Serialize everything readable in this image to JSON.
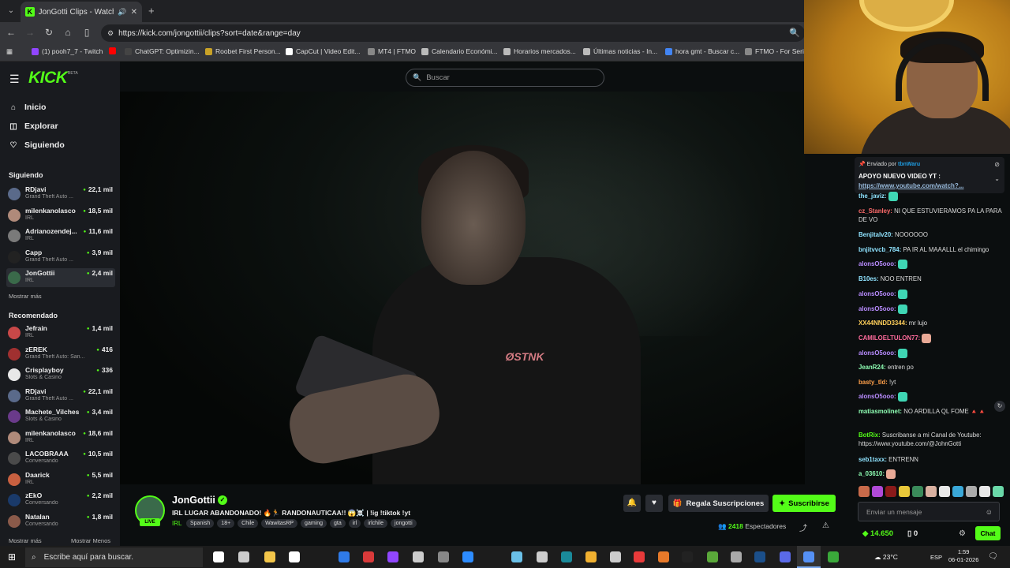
{
  "browser": {
    "tab_title": "JonGotti Clips - Watch Live",
    "url": "https://kick.com/jongottii/clips?sort=date&range=day",
    "bookmarks": [
      {
        "label": "(1) pooh7_7 - Twitch",
        "color": "#9146ff"
      },
      {
        "label": "",
        "color": "#ff0000"
      },
      {
        "label": "ChatGPT: Optimizin...",
        "color": "#444"
      },
      {
        "label": "Roobet First Person...",
        "color": "#c9a227"
      },
      {
        "label": "CapCut | Video Edit...",
        "color": "#ffffff"
      },
      {
        "label": "MT4 | FTMO",
        "color": "#888888"
      },
      {
        "label": "Calendario Económi...",
        "color": "#bbbbbb"
      },
      {
        "label": "Horarios mercados...",
        "color": "#bbbbbb"
      },
      {
        "label": "Últimas noticias - In...",
        "color": "#bbbbbb"
      },
      {
        "label": "hora gmt - Buscar c...",
        "color": "#4285f4"
      },
      {
        "label": "FTMO - For Serio",
        "color": "#888888"
      }
    ]
  },
  "kick": {
    "logo": "KICK",
    "logo_beta": "BETA",
    "search_placeholder": "Buscar",
    "nav": [
      {
        "label": "Inicio",
        "icon": "home-icon"
      },
      {
        "label": "Explorar",
        "icon": "compass-icon"
      },
      {
        "label": "Siguiendo",
        "icon": "heart-icon"
      }
    ],
    "following_title": "Siguiendo",
    "following": [
      {
        "name": "RDjavi",
        "category": "Grand Theft Auto ...",
        "viewers": "22,1 mil",
        "color": "#5a6a8a"
      },
      {
        "name": "milenkanolasco",
        "category": "IRL",
        "viewers": "18,5 mil",
        "color": "#b08a7a"
      },
      {
        "name": "Adrianozendej...",
        "category": "IRL",
        "viewers": "11,6 mil",
        "color": "#7a7a7a"
      },
      {
        "name": "Capp",
        "category": "Grand Theft Auto ...",
        "viewers": "3,9 mil",
        "color": "#222"
      },
      {
        "name": "JonGottii",
        "category": "IRL",
        "viewers": "2,4 mil",
        "color": "#3a6a4a"
      }
    ],
    "show_more_1": "Mostrar más",
    "recommended_title": "Recomendado",
    "recommended": [
      {
        "name": "Jefrain",
        "category": "IRL",
        "viewers": "1,4 mil",
        "color": "#c84848"
      },
      {
        "name": "zEREK",
        "category": "Grand Theft Auto: San...",
        "viewers": "416",
        "color": "#a03030"
      },
      {
        "name": "Crisplayboy",
        "category": "Slots & Casino",
        "viewers": "336",
        "color": "#e8e8e8"
      },
      {
        "name": "RDjavi",
        "category": "Grand Theft Auto ...",
        "viewers": "22,1 mil",
        "color": "#5a6a8a"
      },
      {
        "name": "Machete_Vilches",
        "category": "Slots & Casino",
        "viewers": "3,4 mil",
        "color": "#6a3a8a"
      },
      {
        "name": "milenkanolasco",
        "category": "IRL",
        "viewers": "18,6 mil",
        "color": "#b08a7a"
      },
      {
        "name": "LACOBRAAA",
        "category": "Conversando",
        "viewers": "10,5 mil",
        "color": "#4a4a4a"
      },
      {
        "name": "Daarick",
        "category": "IRL",
        "viewers": "5,5 mil",
        "color": "#c86040"
      },
      {
        "name": "zEkO",
        "category": "Conversando",
        "viewers": "2,2 mil",
        "color": "#1a3a6a"
      },
      {
        "name": "Natalan",
        "category": "Conversando",
        "viewers": "1,8 mil",
        "color": "#8a5a4a"
      }
    ],
    "show_more_2": "Mostrar más",
    "show_less": "Mostrar Menos"
  },
  "stream": {
    "streamer": "JonGottii",
    "live_label": "LIVE",
    "title": "IRL LUGAR ABANDONADO! 🔥🏃 RANDONAUTICAA!! 😱☠️ | !ig !tiktok !yt",
    "category": "IRL",
    "tags": [
      "Spanish",
      "18+",
      "Chile",
      "WawitasRP",
      "gaming",
      "gta",
      "irl",
      "irlchile",
      "jongotti"
    ],
    "gift_label": "Regala Suscripciones",
    "subscribe_label": "Suscribirse",
    "viewers_count": "2418",
    "viewers_label": "Espectadores",
    "shirt_print": "ØSTNK"
  },
  "chat": {
    "pinned_by_label": "Enviado por",
    "pinned_by_user": "tbnWaru",
    "pinned_text": "APOYO NUEVO VIDEO YT :",
    "pinned_link": "https://www.youtube.com/watch?...",
    "messages": [
      {
        "user": "the_javiz:",
        "color": "#8fe3ff",
        "text": "",
        "emote": "green"
      },
      {
        "user": "cz_Stanley:",
        "color": "#ff6b6b",
        "text": "NI QUE ESTUVIERAMOS PA LA PARA DE VO",
        "emote": ""
      },
      {
        "user": "Benjitalv20:",
        "color": "#8fe3ff",
        "text": "NOOOOOO",
        "emote": ""
      },
      {
        "user": "bnjitvvcb_784:",
        "color": "#8fe3ff",
        "text": "PA IR AL MAAALLL el chimingo",
        "emote": ""
      },
      {
        "user": "alonsO5ooo:",
        "color": "#b98cff",
        "text": "",
        "emote": "green"
      },
      {
        "user": "B10es:",
        "color": "#8fe3ff",
        "text": "NOO ENTREN",
        "emote": ""
      },
      {
        "user": "alonsO5ooo:",
        "color": "#b98cff",
        "text": "",
        "emote": "green"
      },
      {
        "user": "alonsO5ooo:",
        "color": "#b98cff",
        "text": "",
        "emote": "green"
      },
      {
        "user": "XX44NNDD3344:",
        "color": "#ffcf5a",
        "text": "mr lujo",
        "emote": ""
      },
      {
        "user": "CAMILOELTULON77:",
        "color": "#ff6b9c",
        "text": "",
        "emote": "hand"
      },
      {
        "user": "alonsO5ooo:",
        "color": "#b98cff",
        "text": "",
        "emote": "green"
      },
      {
        "user": "JeanR24:",
        "color": "#8fffb4",
        "text": "entren po",
        "emote": ""
      },
      {
        "user": "basty_tld:",
        "color": "#ffa04a",
        "text": "!yt",
        "emote": ""
      },
      {
        "user": "alonsO5ooo:",
        "color": "#b98cff",
        "text": "",
        "emote": "green"
      },
      {
        "user": "matiasmolinet:",
        "color": "#8fffb4",
        "text": "NO ARDILLA QL FOME 🔺🔺",
        "emote": ""
      },
      {
        "user": "BotRix:",
        "color": "#53fc18",
        "text": "Suscribanse a mi Canal de Youtube: https://www.youtube.com/@JohnGotti",
        "emote": ""
      },
      {
        "user": "seb1taxx:",
        "color": "#8fe3ff",
        "text": "ENTRENN",
        "emote": ""
      },
      {
        "user": "a_03610:",
        "color": "#8fffb4",
        "text": "",
        "emote": "hand"
      }
    ],
    "input_placeholder": "Enviar un mensaje",
    "points": "14.650",
    "points_secondary": "0",
    "chat_button": "Chat"
  },
  "taskbar": {
    "search_placeholder": "Escribe aquí para buscar.",
    "temperature": "23°C",
    "language": "ESP",
    "time": "1:59",
    "date": "06-01-2026"
  }
}
